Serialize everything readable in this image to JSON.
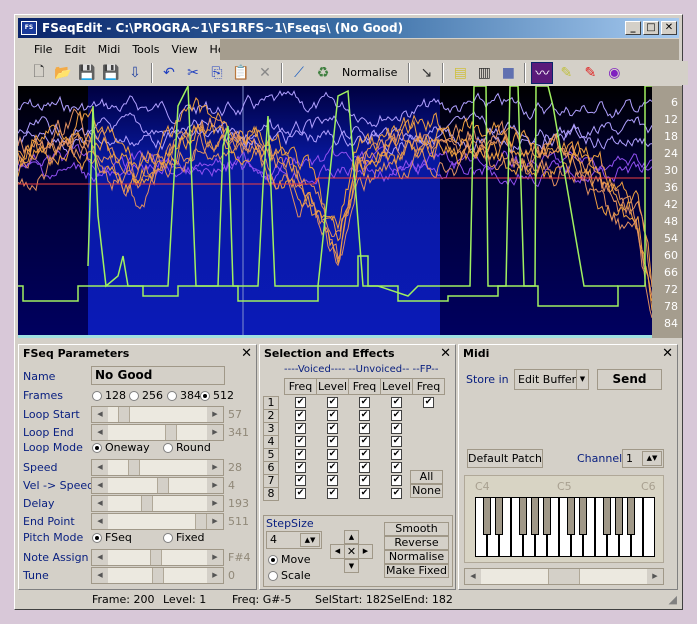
{
  "window": {
    "title": "FSeqEdit - C:\\PROGRA~1\\FS1RFS~1\\Fseqs\\ (No Good)",
    "app_icon": "fseqedit-icon"
  },
  "menu": [
    "File",
    "Edit",
    "Midi",
    "Tools",
    "View",
    "Help"
  ],
  "toolbar": {
    "icons": [
      "new-icon",
      "open-icon",
      "save-icon",
      "save-as-icon",
      "export-icon",
      "undo-icon",
      "cut-icon",
      "copy-icon",
      "paste-icon",
      "delete-icon",
      "curve-icon",
      "convert-icon",
      "pointer-icon",
      "folder-icon",
      "piano-icon",
      "display-icon",
      "graph-mode-icon",
      "pencil-icon",
      "red-pencil-icon",
      "disc-icon"
    ],
    "normalise": "Normalise"
  },
  "graph": {
    "axis_labels": [
      "6",
      "12",
      "18",
      "24",
      "30",
      "36",
      "42",
      "48",
      "54",
      "60",
      "66",
      "72",
      "78",
      "84"
    ],
    "colors": {
      "pitch": "#a0f060",
      "voiced": "#f0a040",
      "unvoiced": "#a060ff",
      "fp": "#f04040"
    }
  },
  "fseq": {
    "title": "FSeq Parameters",
    "name_label": "Name",
    "name_value": "No Good",
    "frames_label": "Frames",
    "frames_options": [
      "128",
      "256",
      "384",
      "512"
    ],
    "frames_selected": "512",
    "sliders": [
      {
        "label": "Loop Start",
        "value": "57",
        "pos": 0.11
      },
      {
        "label": "Loop End",
        "value": "341",
        "pos": 0.66
      },
      {
        "label": "Speed",
        "value": "28",
        "pos": 0.23
      },
      {
        "label": "Vel -> Speed",
        "value": "4",
        "pos": 0.56
      },
      {
        "label": "Delay",
        "value": "193",
        "pos": 0.38
      },
      {
        "label": "End Point",
        "value": "511",
        "pos": 1.0
      },
      {
        "label": "Note Assign",
        "value": "F#4",
        "pos": 0.48
      },
      {
        "label": "Tune",
        "value": "0",
        "pos": 0.5
      }
    ],
    "loop_mode_label": "Loop Mode",
    "loop_modes": [
      "Oneway",
      "Round"
    ],
    "pitch_mode_label": "Pitch Mode",
    "pitch_modes": [
      "FSeq",
      "Fixed"
    ]
  },
  "selection": {
    "title": "Selection and Effects",
    "groups": "----Voiced---- --Unvoiced-- --FP--",
    "columns": [
      "Freq",
      "Level",
      "Freq",
      "Level",
      "Freq"
    ],
    "rows": [
      "1",
      "2",
      "3",
      "4",
      "5",
      "6",
      "7",
      "8"
    ],
    "all": "All",
    "none": "None",
    "stepsize_label": "StepSize",
    "stepsize": "4",
    "move": "Move",
    "scale": "Scale",
    "effects": [
      "Smooth",
      "Reverse",
      "Normalise",
      "Make Fixed"
    ]
  },
  "midi": {
    "title": "Midi",
    "store_label": "Store in",
    "store_value": "Edit Buffer",
    "send": "Send",
    "default_patch": "Default Patch",
    "channel_label": "Channel",
    "channel": "1",
    "keys": [
      "C4",
      "C5",
      "C6"
    ],
    "scroll_pos": 0.5
  },
  "status": {
    "frame": "Frame: 200",
    "level": "Level: 1",
    "freq": "Freq: G#-5",
    "selstart": "SelStart: 182",
    "selend": "SelEnd: 182"
  }
}
